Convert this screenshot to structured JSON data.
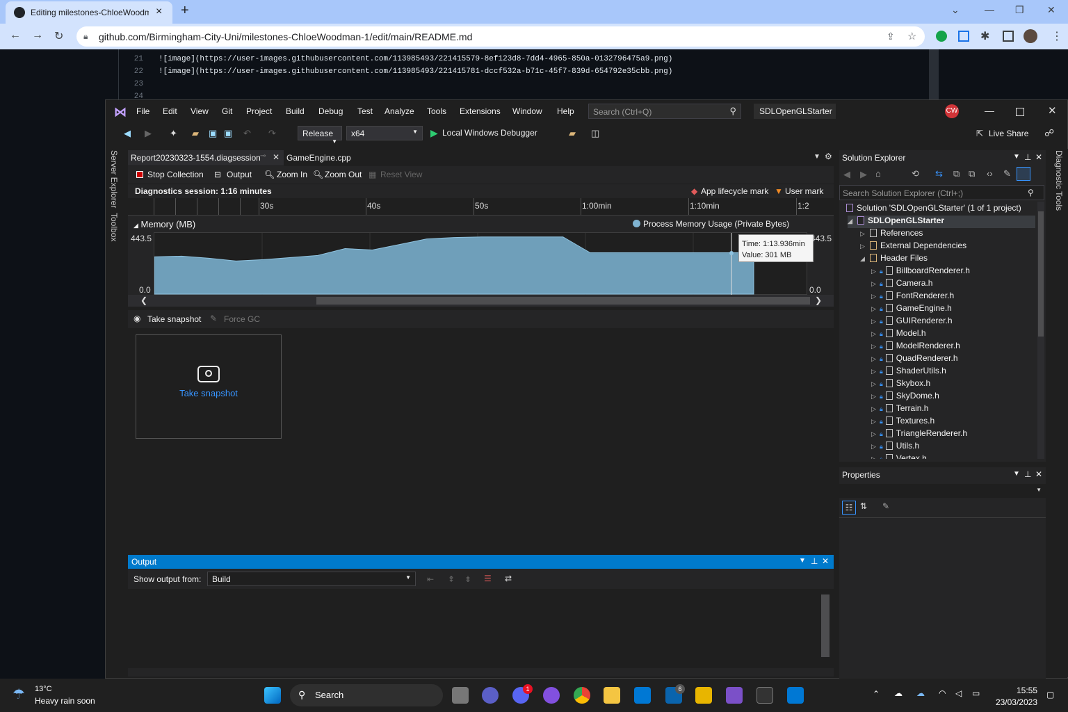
{
  "browser": {
    "tab_title": "Editing milestones-ChloeWoodm",
    "url": "github.com/Birmingham-City-Uni/milestones-ChloeWoodman-1/edit/main/README.md"
  },
  "editor": {
    "lines": [
      {
        "n": "21",
        "t": "![image](https://user-images.githubusercontent.com/113985493/221415579-8ef123d8-7dd4-4965-850a-0132796475a9.png)"
      },
      {
        "n": "22",
        "t": "![image](https://user-images.githubusercontent.com/113985493/221415781-dccf532a-b71c-45f7-839d-654792e35cbb.png)"
      },
      {
        "n": "23",
        "t": ""
      },
      {
        "n": "24",
        "t": ""
      }
    ]
  },
  "vs": {
    "menu": [
      "File",
      "Edit",
      "View",
      "Git",
      "Project",
      "Build",
      "Debug",
      "Test",
      "Analyze",
      "Tools",
      "Extensions",
      "Window",
      "Help"
    ],
    "search_placeholder": "Search (Ctrl+Q)",
    "solution_name": "SDLOpenGLStarter",
    "avatar": "CW",
    "config": "Release",
    "platform": "x64",
    "debugger": "Local Windows Debugger",
    "live_share": "Live Share",
    "side_left": [
      "Server Explorer",
      "Toolbox"
    ],
    "side_right": "Diagnostic Tools",
    "tabs": [
      "Report20230323-1554.diagsession",
      "GameEngine.cpp"
    ],
    "diag_toolbar": {
      "stop": "Stop Collection",
      "output": "Output",
      "zoom_in": "Zoom In",
      "zoom_out": "Zoom Out",
      "reset": "Reset View"
    },
    "session": "Diagnostics session: 1:16 minutes",
    "legend": {
      "app": "App lifecycle mark",
      "user": "User mark",
      "process": "Process Memory Usage (Private Bytes)"
    },
    "ticks": [
      "30s",
      "40s",
      "50s",
      "1:00min",
      "1:10min",
      "1:2"
    ],
    "memory_label": "Memory (MB)",
    "y_max": "443.5",
    "y_min": "0.0",
    "tooltip": {
      "time": "Time: 1:13.936min",
      "value": "Value: 301 MB"
    },
    "snapshot": {
      "take": "Take snapshot",
      "force_gc": "Force GC",
      "box_label": "Take snapshot"
    },
    "solution_explorer": {
      "title": "Solution Explorer",
      "search": "Search Solution Explorer (Ctrl+;)",
      "solution": "Solution 'SDLOpenGLStarter' (1 of 1 project)",
      "project": "SDLOpenGLStarter",
      "nodes": [
        "References",
        "External Dependencies",
        "Header Files"
      ],
      "files": [
        "BillboardRenderer.h",
        "Camera.h",
        "FontRenderer.h",
        "GameEngine.h",
        "GUIRenderer.h",
        "Model.h",
        "ModelRenderer.h",
        "QuadRenderer.h",
        "ShaderUtils.h",
        "Skybox.h",
        "SkyDome.h",
        "Terrain.h",
        "Textures.h",
        "TriangleRenderer.h",
        "Utils.h",
        "Vertex.h"
      ]
    },
    "properties": {
      "title": "Properties"
    },
    "output": {
      "title": "Output",
      "show_from": "Show output from:",
      "source": "Build"
    }
  },
  "chart_data": {
    "type": "area",
    "title": "Memory (MB)",
    "series": [
      {
        "name": "Process Memory Usage (Private Bytes)",
        "values": [
          270,
          275,
          260,
          240,
          250,
          265,
          280,
          330,
          320,
          360,
          400,
          410,
          415,
          415,
          415,
          415,
          300,
          300,
          300,
          300,
          300,
          300,
          301
        ]
      }
    ],
    "ylim": [
      0,
      443.5
    ]
  },
  "taskbar": {
    "weather_temp": "13°C",
    "weather_text": "Heavy rain soon",
    "search": "Search",
    "time": "15:55",
    "date": "23/03/2023",
    "badge_discord": "1",
    "badge_mail": "6"
  }
}
